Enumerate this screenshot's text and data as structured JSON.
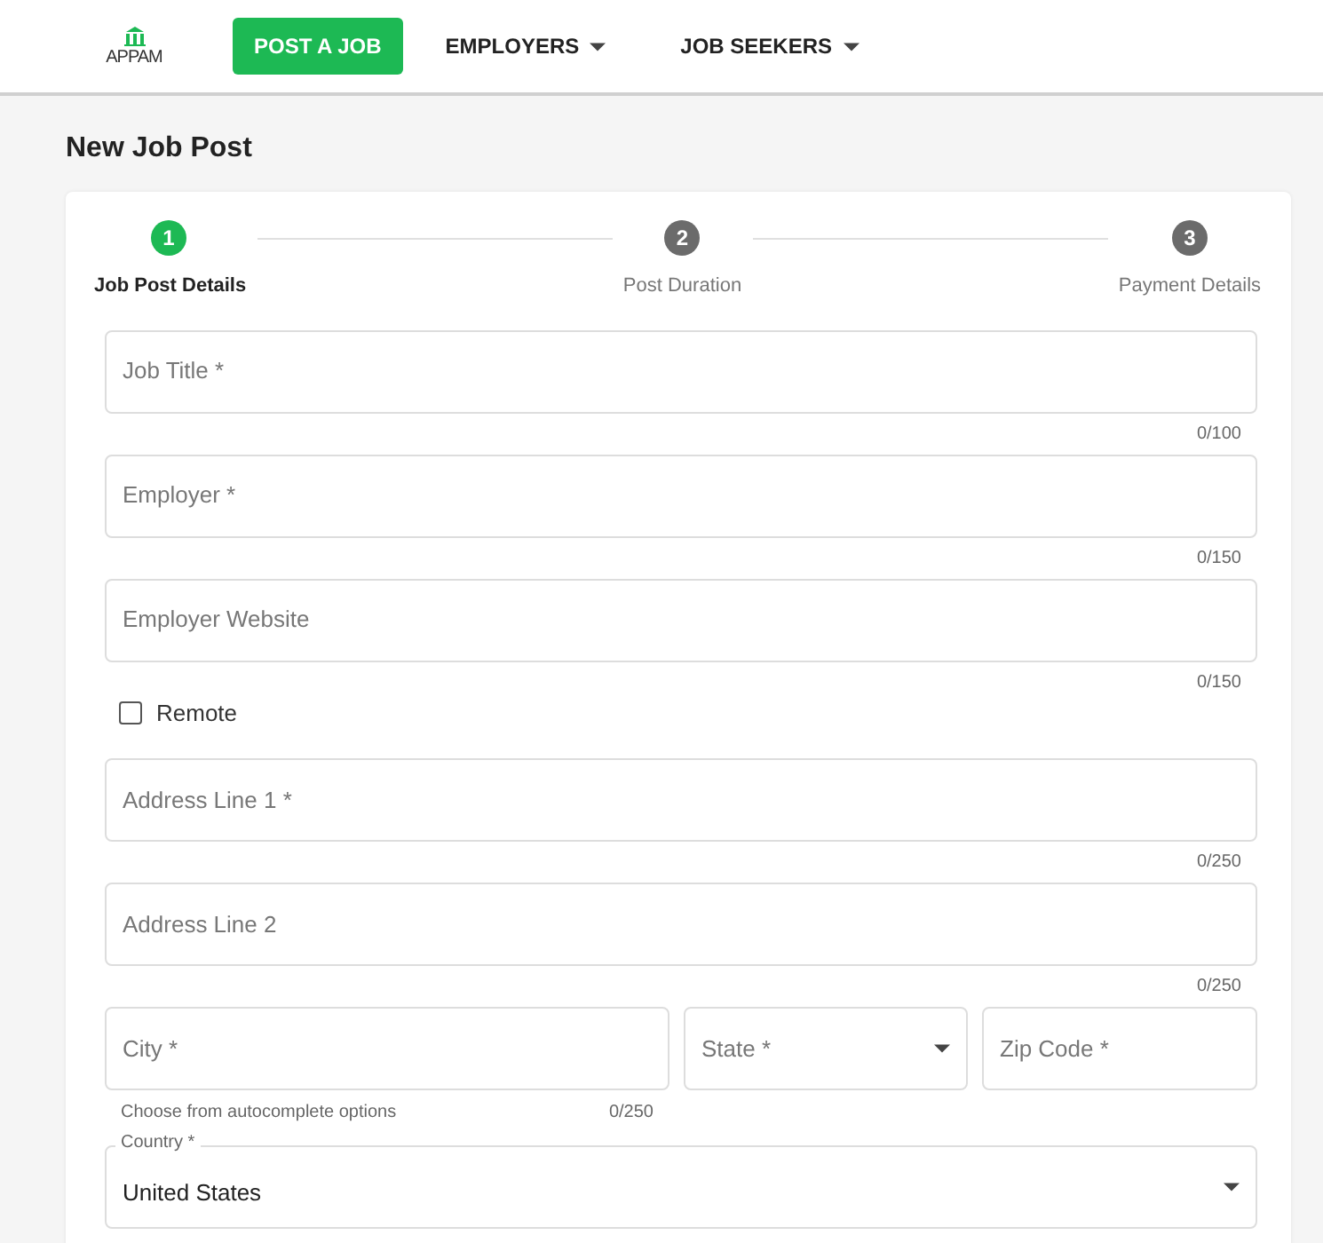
{
  "nav": {
    "logo": "APPAM",
    "items": [
      {
        "label": "POST A JOB",
        "kind": "button"
      },
      {
        "label": "EMPLOYERS",
        "kind": "dropdown"
      },
      {
        "label": "JOB SEEKERS",
        "kind": "dropdown"
      }
    ]
  },
  "page_title": "New Job Post",
  "steps": [
    {
      "number": "1",
      "label": "Job Post Details",
      "selected": true
    },
    {
      "number": "2",
      "label": "Post Duration",
      "selected": false
    },
    {
      "number": "3",
      "label": "Payment Details",
      "selected": false
    }
  ],
  "form": [
    {
      "kind": "text",
      "placeholder": "Job Title *",
      "counter": "0/100"
    },
    {
      "kind": "text",
      "placeholder": "Employer *",
      "counter": "0/150"
    },
    {
      "kind": "text",
      "placeholder": "Employer Website",
      "counter": "0/150"
    },
    {
      "kind": "checkbox",
      "label": "Remote",
      "checked": false
    },
    {
      "kind": "text",
      "placeholder": "Address Line 1 *",
      "counter": "0/250"
    },
    {
      "kind": "text",
      "placeholder": "Address Line 2",
      "counter": "0/250"
    },
    {
      "kind": "row",
      "fields": [
        {
          "kind": "text",
          "placeholder": "City *",
          "hint": "Choose from autocomplete options",
          "counter": "0/250"
        },
        {
          "kind": "select",
          "placeholder": "State *"
        },
        {
          "kind": "text",
          "placeholder": "Zip Code *"
        }
      ]
    },
    {
      "kind": "select",
      "label": "Country *",
      "value": "United States"
    }
  ]
}
